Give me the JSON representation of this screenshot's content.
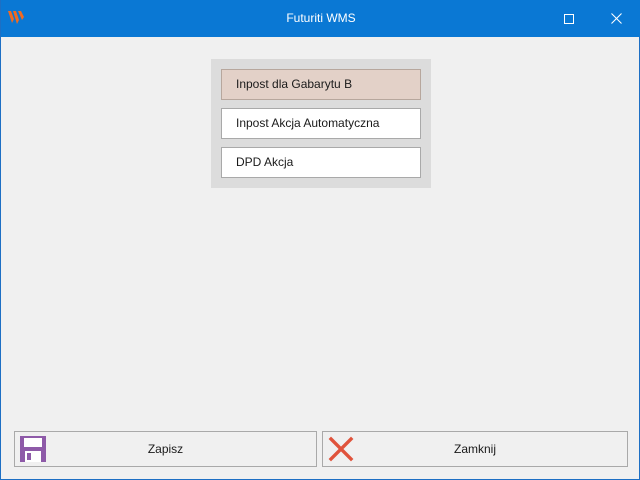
{
  "window": {
    "title": "Futuriti WMS",
    "accent_color": "#0a78d4",
    "logo_icon": "futuriti-logo",
    "controls": {
      "maximize_icon": "maximize-icon",
      "close_icon": "close-icon"
    }
  },
  "choices": [
    {
      "label": "Inpost dla Gabarytu B",
      "selected": true
    },
    {
      "label": "Inpost Akcja Automatyczna",
      "selected": false
    },
    {
      "label": "DPD Akcja",
      "selected": false
    }
  ],
  "selected_color": "#e3d1c8",
  "footer": {
    "save": {
      "label": "Zapisz",
      "icon": "floppy-disk-icon",
      "icon_color": "#8e5aa8"
    },
    "close": {
      "label": "Zamknij",
      "icon": "red-x-icon",
      "icon_color": "#e0533c"
    }
  }
}
